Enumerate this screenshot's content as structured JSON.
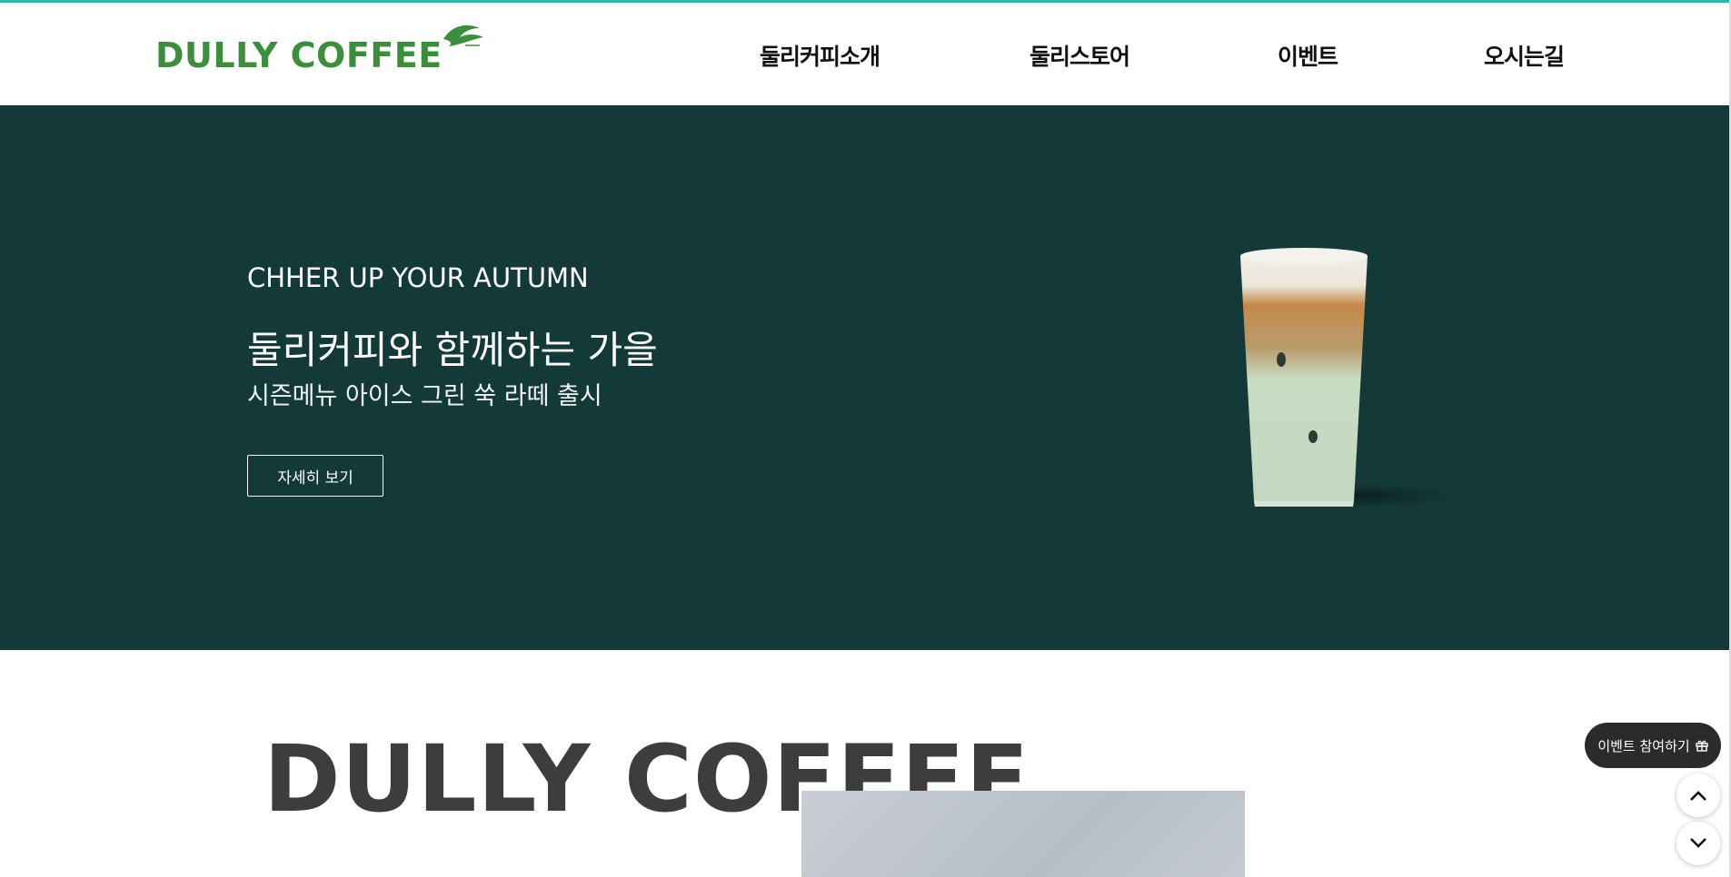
{
  "header": {
    "logo_text": "DULLY COFFEE",
    "nav": [
      "둘리커피소개",
      "둘리스토어",
      "이벤트",
      "오시는길"
    ]
  },
  "hero": {
    "subtitle": "CHHER UP YOUR AUTUMN",
    "title": "둘리커피와 함께하는 가을",
    "description": "시즌메뉴 아이스 그린 쑥 라떼 출시",
    "button_label": "자세히 보기",
    "background_color": "#133a38"
  },
  "brand_section": {
    "heading": "DULLY COFFEE"
  },
  "floating": {
    "event_label": "이벤트 참여하기",
    "event_icon": "gift-icon",
    "up_icon": "chevron-up-icon",
    "down_icon": "chevron-down-icon"
  },
  "colors": {
    "accent_green": "#3b8f3b",
    "top_line": "#34b3a8"
  }
}
